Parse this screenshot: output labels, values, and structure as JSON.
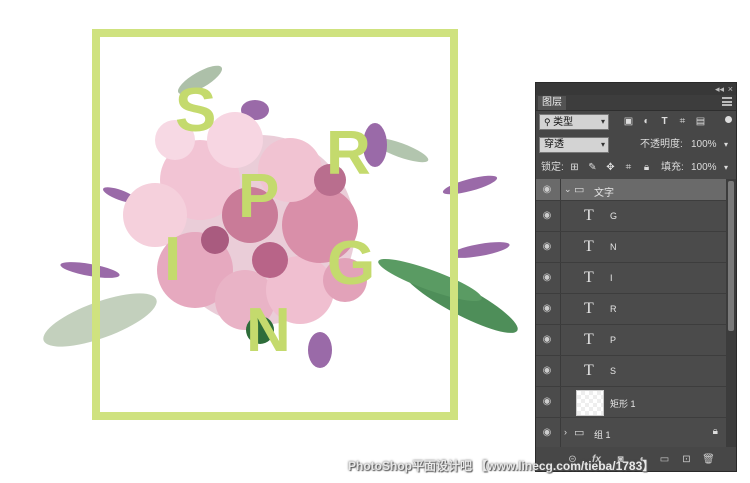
{
  "canvas": {
    "letters": [
      "S",
      "P",
      "R",
      "I",
      "G",
      "N"
    ],
    "frame_color": "#cfe27f",
    "letter_color": "#c4da6d"
  },
  "panel": {
    "tab_label": "图层",
    "filter_label": "类型",
    "blend_mode": "穿透",
    "opacity_label": "不透明度:",
    "opacity_value": "100%",
    "lock_label": "锁定:",
    "fill_label": "填充:",
    "fill_value": "100%",
    "layers": [
      {
        "name": "文字",
        "kind": "group-open"
      },
      {
        "name": "G",
        "kind": "text"
      },
      {
        "name": "N",
        "kind": "text"
      },
      {
        "name": "I",
        "kind": "text"
      },
      {
        "name": "R",
        "kind": "text"
      },
      {
        "name": "P",
        "kind": "text"
      },
      {
        "name": "S",
        "kind": "text"
      },
      {
        "name": "矩形 1",
        "kind": "shape"
      },
      {
        "name": "组 1",
        "kind": "group-closed"
      }
    ],
    "bottom_fx": "fx"
  },
  "watermark": "PhotoShop平面设计吧 【www.linecg.com/tieba/1783】"
}
